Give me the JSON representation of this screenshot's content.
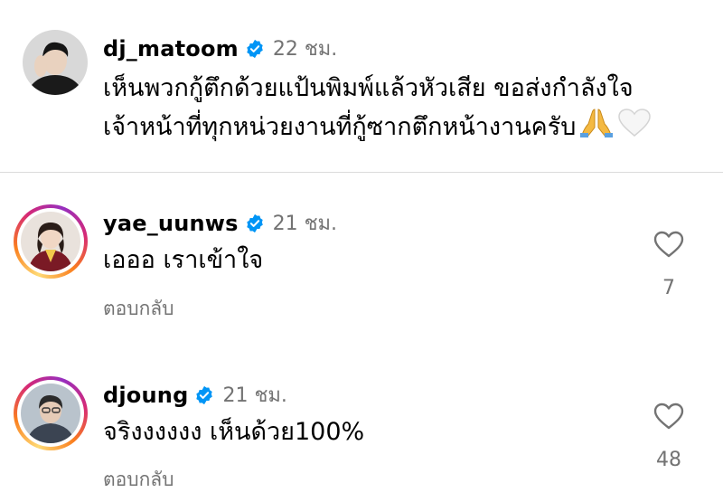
{
  "caption": {
    "username": "dj_matoom",
    "time": "22 ชม.",
    "line1": "เห็นพวกกู้ตึกด้วยแป้นพิมพ์แล้วหัวเสีย ขอส่งกำลังใจ",
    "line2": "เจ้าหน้าที่ทุกหน่วยงานที่กู้ซากตึกหน้างานครับ",
    "emojis": [
      "folded-hands-icon",
      "white-heart-icon"
    ]
  },
  "comments": [
    {
      "username": "yae_uunws",
      "time": "21 ชม.",
      "text": "เอออ เราเข้าใจ",
      "reply_label": "ตอบกลับ",
      "likes": "7"
    },
    {
      "username": "djoung",
      "time": "21 ชม.",
      "text": "จริงงงงงง เห็นด้วย100%",
      "reply_label": "ตอบกลับ",
      "likes": "48"
    }
  ],
  "colors": {
    "verified": "#0095f6",
    "secondary_text": "#737373",
    "divider": "#dbdbdb"
  }
}
